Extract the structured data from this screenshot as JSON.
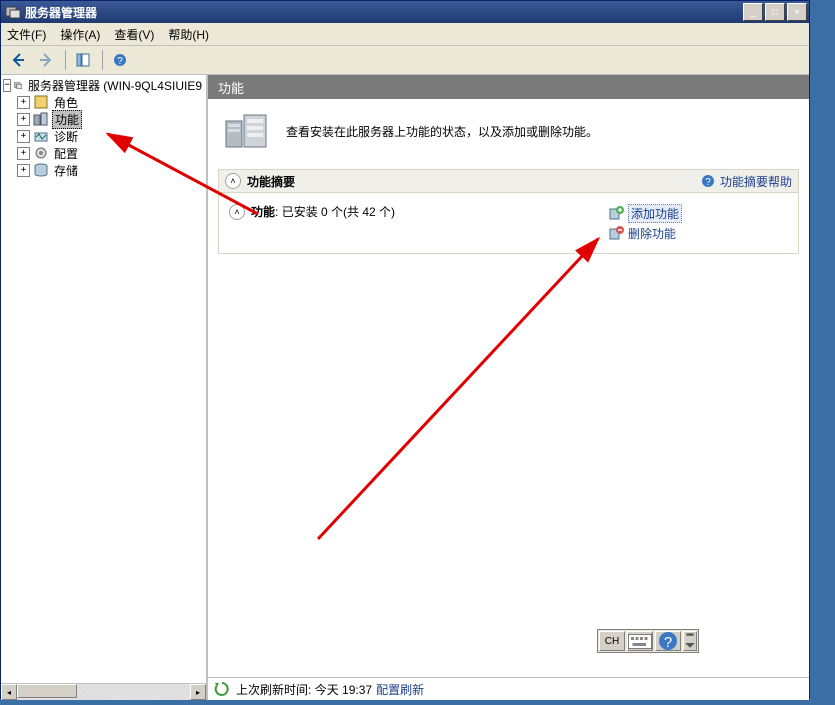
{
  "window": {
    "title": "服务器管理器",
    "btn_min": "_",
    "btn_max": "□",
    "btn_close": "×"
  },
  "menu": {
    "file": "文件(F)",
    "action": "操作(A)",
    "view": "查看(V)",
    "help": "帮助(H)"
  },
  "tree": {
    "root": "服务器管理器 (WIN-9QL4SIUIE9",
    "roles": "角色",
    "features": "功能",
    "diagnostics": "诊断",
    "configuration": "配置",
    "storage": "存储"
  },
  "content": {
    "title": "功能",
    "summary": "查看安装在此服务器上功能的状态，以及添加或删除功能。",
    "group_title": "功能摘要",
    "group_help": "功能摘要帮助",
    "features_label": "功能",
    "features_status": "已安装 0 个(共 42 个)",
    "add_feature": "添加功能",
    "remove_feature": "删除功能"
  },
  "status": {
    "last_refresh_label": "上次刷新时间:",
    "last_refresh_value": "今天 19:37",
    "configure_refresh": "配置刷新"
  },
  "ime": {
    "lang": "CH"
  }
}
